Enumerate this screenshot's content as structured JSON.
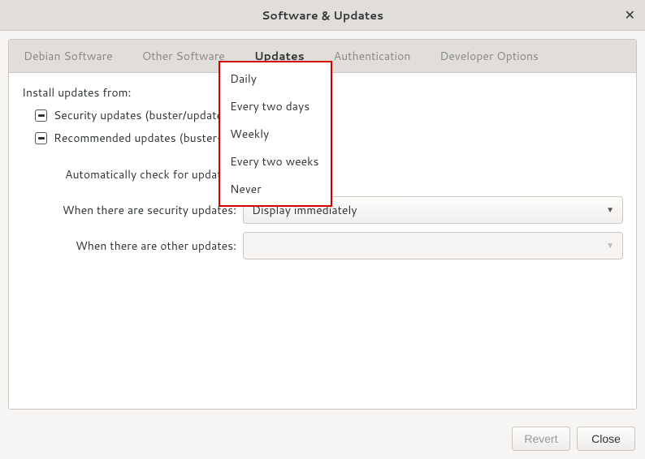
{
  "window": {
    "title": "Software & Updates"
  },
  "tabs": {
    "debian": "Debian Software",
    "other": "Other Software",
    "updates": "Updates",
    "auth": "Authentication",
    "dev": "Developer Options"
  },
  "updates_panel": {
    "install_from": "Install updates from:",
    "security_label": "Security updates (buster/updates)",
    "recommended_label": "Recommended updates (buster-updates)",
    "auto_check_label": "Automatically check for updates:",
    "security_updates_label": "When there are security updates:",
    "other_updates_label": "When there are other updates:",
    "security_combo_value": "Display immediately",
    "other_combo_value": "",
    "auto_check_options": {
      "daily": "Daily",
      "two_days": "Every two days",
      "weekly": "Weekly",
      "two_weeks": "Every two weeks",
      "never": "Never"
    }
  },
  "footer": {
    "revert": "Revert",
    "close": "Close"
  }
}
